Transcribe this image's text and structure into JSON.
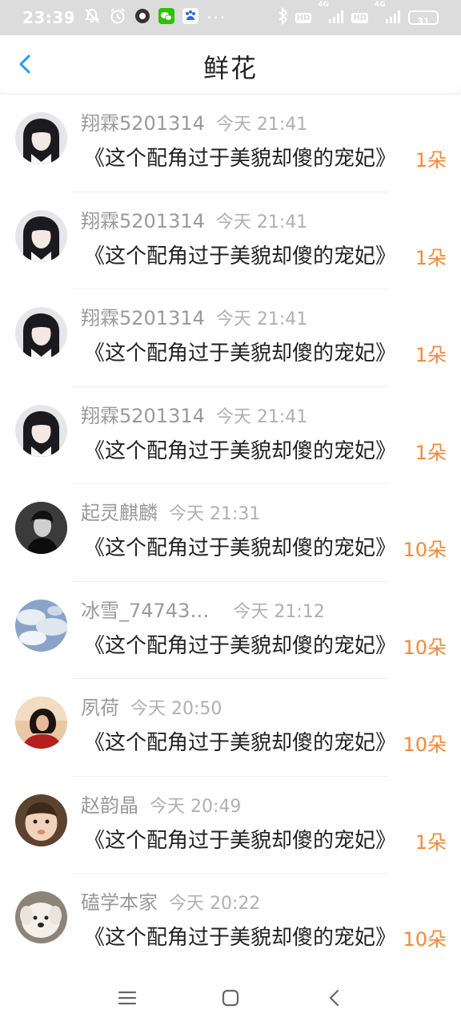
{
  "status_bar": {
    "time": "23:39",
    "more": "···",
    "battery": "31",
    "network_1": "4G",
    "network_2": "4G",
    "hd_1": "HD",
    "hd_2": "HD"
  },
  "header": {
    "title": "鲜花"
  },
  "items": [
    {
      "name": "翔霖5201314",
      "time": "今天 21:41",
      "message": "《这个配角过于美貌却傻的宠妃》",
      "amount": "1朵",
      "avatar": "girl"
    },
    {
      "name": "翔霖5201314",
      "time": "今天 21:41",
      "message": "《这个配角过于美貌却傻的宠妃》",
      "amount": "1朵",
      "avatar": "girl"
    },
    {
      "name": "翔霖5201314",
      "time": "今天 21:41",
      "message": "《这个配角过于美貌却傻的宠妃》",
      "amount": "1朵",
      "avatar": "girl"
    },
    {
      "name": "翔霖5201314",
      "time": "今天 21:41",
      "message": "《这个配角过于美貌却傻的宠妃》",
      "amount": "1朵",
      "avatar": "girl"
    },
    {
      "name": "起灵麒麟",
      "time": "今天 21:31",
      "message": "《这个配角过于美貌却傻的宠妃》",
      "amount": "10朵",
      "avatar": "boy"
    },
    {
      "name": "冰雪_74743…",
      "time": "今天 21:12",
      "message": "《这个配角过于美貌却傻的宠妃》",
      "amount": "10朵",
      "avatar": "sky"
    },
    {
      "name": "夙荷",
      "time": "今天 20:50",
      "message": "《这个配角过于美貌却傻的宠妃》",
      "amount": "10朵",
      "avatar": "woman"
    },
    {
      "name": "赵韵晶",
      "time": "今天 20:49",
      "message": "《这个配角过于美貌却傻的宠妃》",
      "amount": "1朵",
      "avatar": "baby"
    },
    {
      "name": "磕学本家",
      "time": "今天 20:22",
      "message": "《这个配角过于美貌却傻的宠妃》",
      "amount": "10朵",
      "avatar": "dog"
    }
  ],
  "colors": {
    "accent": "#1a9cf0",
    "amount": "#f08a3b",
    "name": "#9a9a9a",
    "status_bar_bg": "#dcdcdc"
  },
  "icons": {
    "back": "chevron-left-icon",
    "nav_menu": "menu-icon",
    "nav_home": "home-square-icon",
    "nav_back": "back-triangle-icon"
  }
}
